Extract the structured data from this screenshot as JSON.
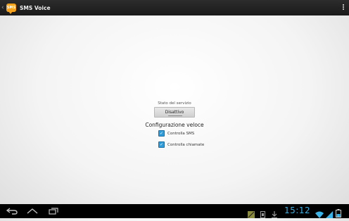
{
  "action_bar": {
    "app_icon_text": "SMS",
    "title": "SMS Voice"
  },
  "service": {
    "status_label": "Stato del servizio",
    "toggle_label": "Disattivo"
  },
  "quick_config": {
    "title": "Configurazione veloce",
    "options": [
      {
        "label": "Controlla SMS",
        "checked": true
      },
      {
        "label": "Controlla chiamate",
        "checked": true
      }
    ]
  },
  "system_bar": {
    "time": "15:12",
    "accent_color": "#39b3e8"
  }
}
